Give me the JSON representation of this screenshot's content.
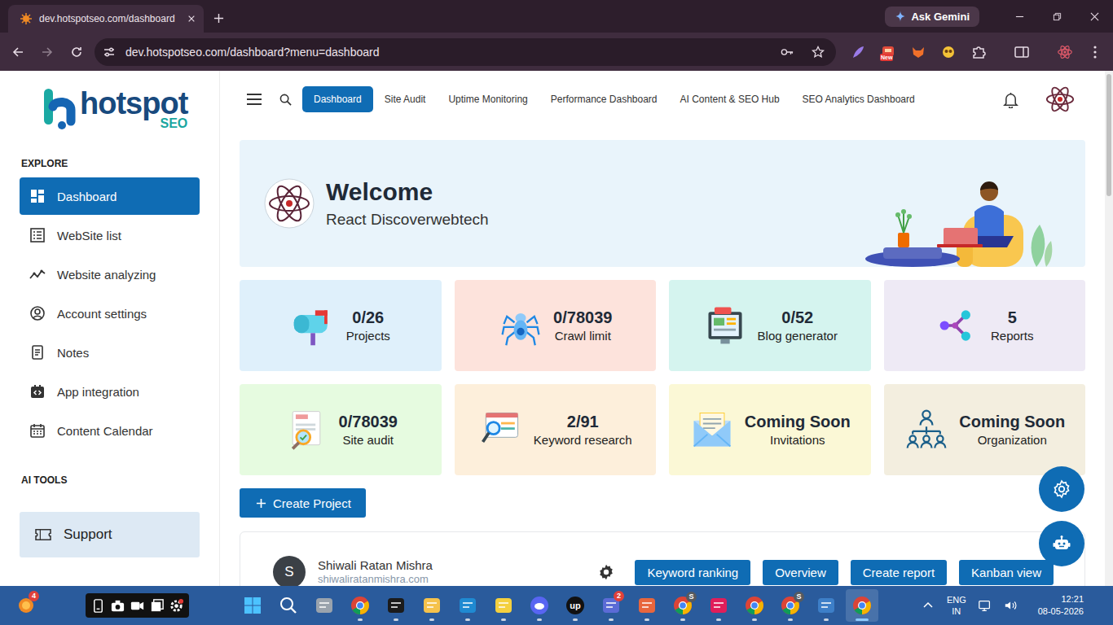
{
  "browser": {
    "tab": {
      "title": "dev.hotspotseo.com/dashboard",
      "selected": true
    },
    "gemini": "Ask Gemini",
    "url": "dev.hotspotseo.com/dashboard?menu=dashboard",
    "bookmarked": false,
    "extension_badge": "New"
  },
  "app": {
    "logo": {
      "name": "hotspot",
      "suffix": "SEO"
    },
    "sidebar": {
      "explore_title": "EXPLORE",
      "items": [
        {
          "label": "Dashboard",
          "selected": true
        },
        {
          "label": "WebSite list",
          "selected": false
        },
        {
          "label": "Website analyzing",
          "selected": false
        },
        {
          "label": "Account settings",
          "selected": false
        },
        {
          "label": "Notes",
          "selected": false
        },
        {
          "label": "App integration",
          "selected": false
        },
        {
          "label": "Content Calendar",
          "selected": false
        }
      ],
      "ai_tools_title": "AI TOOLS",
      "support": "Support"
    },
    "nav": [
      {
        "label": "Dashboard",
        "selected": true
      },
      {
        "label": "Site Audit",
        "selected": false
      },
      {
        "label": "Uptime Monitoring",
        "selected": false
      },
      {
        "label": "Performance Dashboard",
        "selected": false
      },
      {
        "label": "AI Content & SEO Hub",
        "selected": false
      },
      {
        "label": "SEO Analytics Dashboard",
        "selected": false
      }
    ],
    "welcome": {
      "title": "Welcome",
      "user": "React Discoverwebtech"
    },
    "stats": [
      {
        "value": "0/26",
        "label": "Projects",
        "color": "#dff0fb"
      },
      {
        "value": "0/78039",
        "label": "Crawl limit",
        "color": "#fde3dc"
      },
      {
        "value": "0/52",
        "label": "Blog generator",
        "color": "#d5f4ef"
      },
      {
        "value": "5",
        "label": "Reports",
        "color": "#eeeaf5"
      },
      {
        "value": "0/78039",
        "label": "Site audit",
        "color": "#e6fbe0"
      },
      {
        "value": "2/91",
        "label": "Keyword research",
        "color": "#fdefdb"
      },
      {
        "value": "Coming Soon",
        "label": "Invitations",
        "color": "#fbf8d6"
      },
      {
        "value": "Coming Soon",
        "label": "Organization",
        "color": "#f3eedf"
      }
    ],
    "create_project": "Create Project",
    "project": {
      "avatar": "S",
      "name": "Shiwali Ratan Mishra",
      "url": "shiwaliratanmishra.com",
      "actions": [
        "Keyword ranking",
        "Overview",
        "Create report",
        "Kanban view"
      ]
    }
  },
  "taskbar": {
    "widgets_badge": "4",
    "apps": [
      {
        "kind": "windows",
        "color": "#4cc2ff",
        "label": "",
        "badge": "",
        "running": false,
        "selected": false
      },
      {
        "kind": "search",
        "color": "#ffffff",
        "label": "",
        "badge": "",
        "running": false,
        "selected": false
      },
      {
        "kind": "tile",
        "color": "#9aa3ad",
        "label": "",
        "badge": "",
        "running": false,
        "selected": false
      },
      {
        "kind": "chrome",
        "color": "#db4437",
        "label": "",
        "badge": "",
        "running": true,
        "selected": false
      },
      {
        "kind": "tile",
        "color": "#1b1b1b",
        "label": "",
        "badge": "",
        "running": true,
        "selected": false
      },
      {
        "kind": "tile",
        "color": "#f5c24c",
        "label": "",
        "badge": "",
        "running": true,
        "selected": false
      },
      {
        "kind": "tile",
        "color": "#1f8ad2",
        "label": "",
        "badge": "",
        "running": true,
        "selected": false
      },
      {
        "kind": "tile",
        "color": "#f4d03f",
        "label": "",
        "badge": "",
        "running": true,
        "selected": false
      },
      {
        "kind": "circle",
        "color": "#5865f2",
        "label": "",
        "badge": "",
        "running": true,
        "selected": false
      },
      {
        "kind": "circle",
        "color": "#111111",
        "label": "up",
        "badge": "",
        "running": true,
        "selected": false
      },
      {
        "kind": "tile",
        "color": "#5b6bd6",
        "label": "",
        "badge": "2",
        "running": true,
        "selected": false
      },
      {
        "kind": "tile",
        "color": "#e8663d",
        "label": "",
        "badge": "",
        "running": true,
        "selected": false
      },
      {
        "kind": "chrome",
        "color": "#db4437",
        "label": "",
        "badge": "S",
        "running": true,
        "selected": false
      },
      {
        "kind": "tile",
        "color": "#e01e5a",
        "label": "",
        "badge": "",
        "running": true,
        "selected": false
      },
      {
        "kind": "chrome",
        "color": "#db4437",
        "label": "",
        "badge": "",
        "running": true,
        "selected": false
      },
      {
        "kind": "chrome",
        "color": "#db4437",
        "label": "",
        "badge": "S",
        "running": true,
        "selected": false
      },
      {
        "kind": "tile",
        "color": "#3d7fc8",
        "label": "",
        "badge": "",
        "running": true,
        "selected": false
      },
      {
        "kind": "chrome",
        "color": "#db4437",
        "label": "",
        "badge": "",
        "running": true,
        "selected": true
      }
    ],
    "tray": {
      "language": "ENG",
      "region": "IN",
      "time": "12:21",
      "date": "08-05-2026"
    }
  }
}
